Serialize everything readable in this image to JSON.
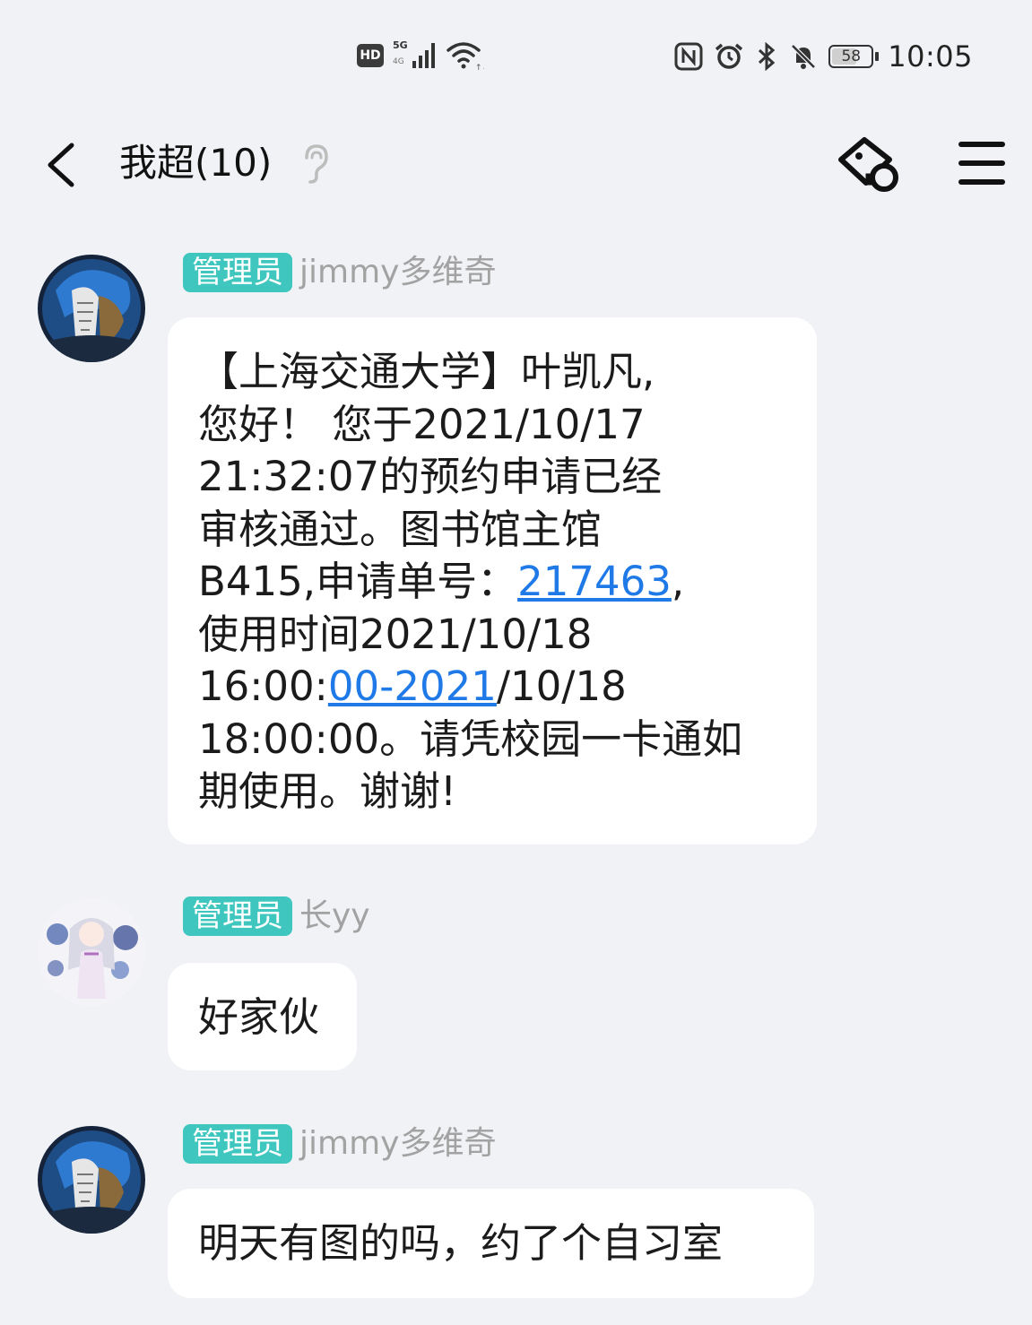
{
  "status_bar": {
    "hd_label": "HD",
    "network_5g": "5G",
    "network_4g": "4G",
    "battery_level": "58",
    "time": "10:05"
  },
  "header": {
    "title": "我超(10)"
  },
  "messages": [
    {
      "role_badge": "管理员",
      "sender": "jimmy多维奇",
      "lines": [
        "【上海交通大学】叶凯凡,",
        "您好！ 您于2021/10/17",
        "21:32:07的预约申请已经",
        "审核通过。图书馆主馆",
        {
          "pre": "B415,申请单号：",
          "link": "217463",
          "post": ","
        },
        "使用时间2021/10/18",
        {
          "pre": "16:00:",
          "link": "00-2021",
          "post": "/10/18"
        },
        "18:00:00。请凭校园一卡通如",
        "期使用。谢谢!"
      ]
    },
    {
      "role_badge": "管理员",
      "sender": "长yy",
      "text": "好家伙"
    },
    {
      "role_badge": "管理员",
      "sender": "jimmy多维奇",
      "text": "明天有图的吗，约了个自习室"
    }
  ]
}
